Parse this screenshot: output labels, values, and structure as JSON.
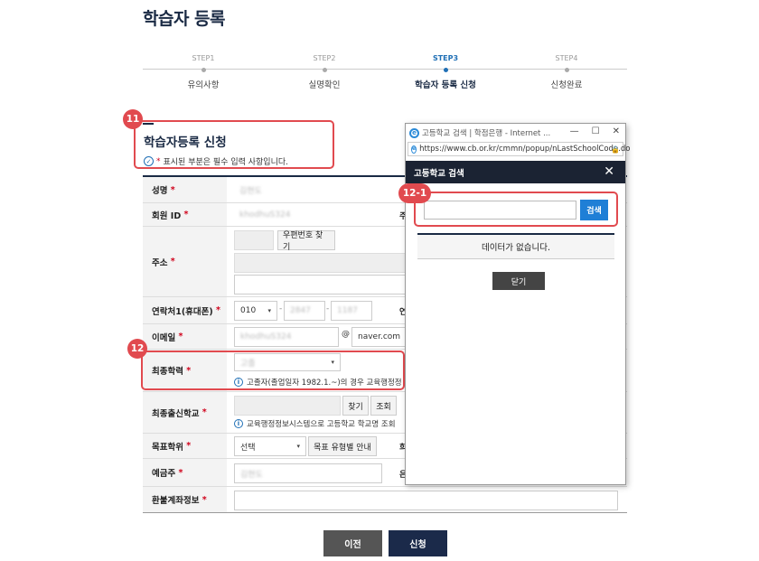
{
  "page": {
    "title": "학습자 등록"
  },
  "steps": [
    {
      "num": "STEP1",
      "label": "유의사항"
    },
    {
      "num": "STEP2",
      "label": "실명확인"
    },
    {
      "num": "STEP3",
      "label": "학습자 등록 신청"
    },
    {
      "num": "STEP4",
      "label": "신청완료"
    }
  ],
  "active_step": 3,
  "section": {
    "title": "학습자등록 신청",
    "req_star": "*",
    "req_note": "표시된 부분은 필수 입력 사항입니다."
  },
  "callouts": {
    "c11": "11",
    "c12": "12",
    "c12_1": "12-1"
  },
  "form": {
    "star": "*",
    "name": {
      "label": "성명",
      "value": "김현도"
    },
    "member_id": {
      "label": "회원 ID",
      "value": "khodhuS324",
      "cut_label": "주"
    },
    "address": {
      "label": "주소",
      "zip_button": "우편번호 찾기"
    },
    "phone": {
      "label": "연락처1(휴대폰)",
      "prefix": "010",
      "mid": "2847",
      "last": "1187",
      "sep": "-",
      "cut_label": "연"
    },
    "email": {
      "label": "이메일",
      "local": "khodhuS324",
      "at": "@",
      "domain": "naver.com"
    },
    "education": {
      "label": "최종학력",
      "value": "고졸",
      "note": "고졸자(졸업일자 1982.1.~)의 경우 교육행정정"
    },
    "school": {
      "label": "최종출신학교",
      "find": "찾기",
      "lookup": "조회",
      "note": "교육행정정보시스템으로 고등학교 학교명 조회"
    },
    "degree": {
      "label": "목표학위",
      "value": "선택",
      "guide": "목표 유형별 안내",
      "cut_label": "희"
    },
    "depositor": {
      "label": "예금주",
      "value": "김현도",
      "cut_label": "은"
    },
    "refund": {
      "label": "환불계좌정보"
    }
  },
  "buttons": {
    "prev": "이전",
    "submit": "신청"
  },
  "popup": {
    "window_title": "고등학교 검색 | 학점은행 - Internet ...",
    "controls": {
      "min": "—",
      "max": "☐",
      "close": "✕"
    },
    "url": "https://www.cb.or.kr/cmmn/popup/nLastSchoolCode.do",
    "header": "고등학교 검색",
    "header_close": "✕",
    "search_value": "",
    "search_button": "검색",
    "result": "데이터가 없습니다.",
    "close_button": "닫기"
  },
  "colors": {
    "accent": "#1f7fd6",
    "navy": "#1a2a44",
    "callout": "#e14a4f",
    "required": "#d0021b"
  }
}
